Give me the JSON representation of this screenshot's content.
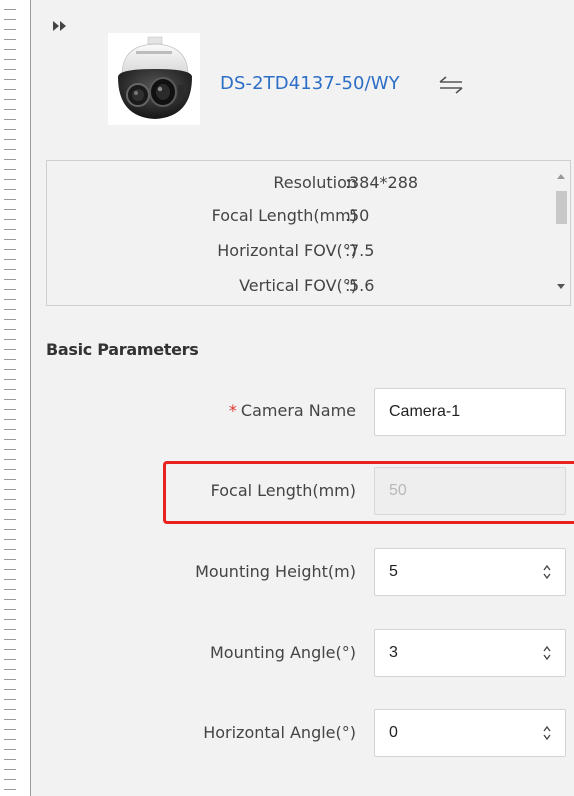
{
  "device": {
    "model": "DS-2TD4137-50/WY",
    "image_icon": "thermal-ptz-camera-icon"
  },
  "specs": [
    {
      "label": "Resolution",
      "value": "384*288"
    },
    {
      "label": "Focal Length(mm)",
      "value": "50"
    },
    {
      "label": "Horizontal FOV(°)",
      "value": "7.5"
    },
    {
      "label": "Vertical FOV(°)",
      "value": "5.6"
    }
  ],
  "basic": {
    "title": "Basic Parameters",
    "camera_name": {
      "label": "Camera Name",
      "value": "Camera-1",
      "required": true
    },
    "focal_length": {
      "label": "Focal Length(mm)",
      "value": "50",
      "disabled": true
    },
    "mounting_height": {
      "label": "Mounting Height(m)",
      "value": "5"
    },
    "mounting_angle": {
      "label": "Mounting Angle(°)",
      "value": "3"
    },
    "horizontal_angle": {
      "label": "Horizontal Angle(°)",
      "value": "0"
    }
  },
  "colors": {
    "accent": "#2d6ec7",
    "highlight": "#e8231f",
    "required": "#e0342a"
  }
}
